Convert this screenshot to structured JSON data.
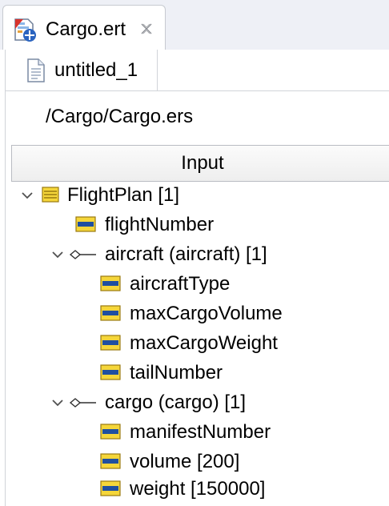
{
  "editor_tab": {
    "title": "Cargo.ert",
    "icon": "cargo-ert-file-icon",
    "close_icon": "close-icon"
  },
  "inner_tab": {
    "label": "untitled_1",
    "icon": "document-icon"
  },
  "path": "/Cargo/Cargo.ers",
  "input_header": "Input",
  "tree": {
    "flightplan": {
      "label": "FlightPlan [1]",
      "icon": "entity-icon",
      "expanded": true
    },
    "flightnumber": {
      "label": "flightNumber",
      "icon": "attribute-icon"
    },
    "aircraft": {
      "label": "aircraft (aircraft) [1]",
      "icon": "association-icon",
      "expanded": true
    },
    "aircrafttype": {
      "label": "aircraftType",
      "icon": "attribute-icon"
    },
    "maxcargovolume": {
      "label": "maxCargoVolume",
      "icon": "attribute-icon"
    },
    "maxcargoweight": {
      "label": "maxCargoWeight",
      "icon": "attribute-icon"
    },
    "tailnumber": {
      "label": "tailNumber",
      "icon": "attribute-icon"
    },
    "cargo": {
      "label": "cargo (cargo) [1]",
      "icon": "association-icon",
      "expanded": true
    },
    "manifestnumber": {
      "label": "manifestNumber",
      "icon": "attribute-icon"
    },
    "volume": {
      "label": "volume [200]",
      "icon": "attribute-icon"
    },
    "weight": {
      "label": "weight [150000]",
      "icon": "attribute-icon"
    }
  },
  "colors": {
    "attribute_icon_fill": "#f5d63a",
    "attribute_icon_bar": "#1f4fa0",
    "tab_background": "#eef0f6",
    "twisty": "#505050"
  }
}
